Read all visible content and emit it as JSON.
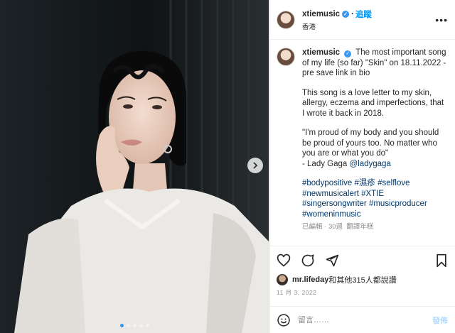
{
  "header": {
    "username": "xtiemusic",
    "follow_label": "追蹤",
    "location": "香港",
    "more_icon": "more-horizontal-icon"
  },
  "caption": {
    "username": "xtiemusic",
    "line1": "The most important song of my life (so far) \"Skin\" on 18.11.2022 - pre save link in bio",
    "paragraph2": "This song is a love letter to my skin, allergy, eczema and imperfections, that I wrote it back in 2018.",
    "quote": "\"I'm proud of my body and you should be proud of yours too. No matter who you are or what you do\"",
    "attribution": "- Lady Gaga ",
    "mention": "@ladygaga",
    "hashtags": "#bodypositive #濕疹 #selflove #newmusicalert #XTIE #singersongwriter #musicproducer #womeninmusic",
    "edited": "已編輯",
    "age": "30週",
    "translate": "翻譯年糕"
  },
  "actions": {
    "like": "heart-icon",
    "comment": "comment-icon",
    "share": "send-icon",
    "save": "bookmark-icon"
  },
  "likes": {
    "user": "mr.lifeday",
    "rest": "和其他315人都說讚"
  },
  "date": "11 月 3, 2022",
  "comment": {
    "placeholder": "留言……",
    "post_label": "發佈"
  },
  "carousel": {
    "slides": 5,
    "active": 0
  }
}
